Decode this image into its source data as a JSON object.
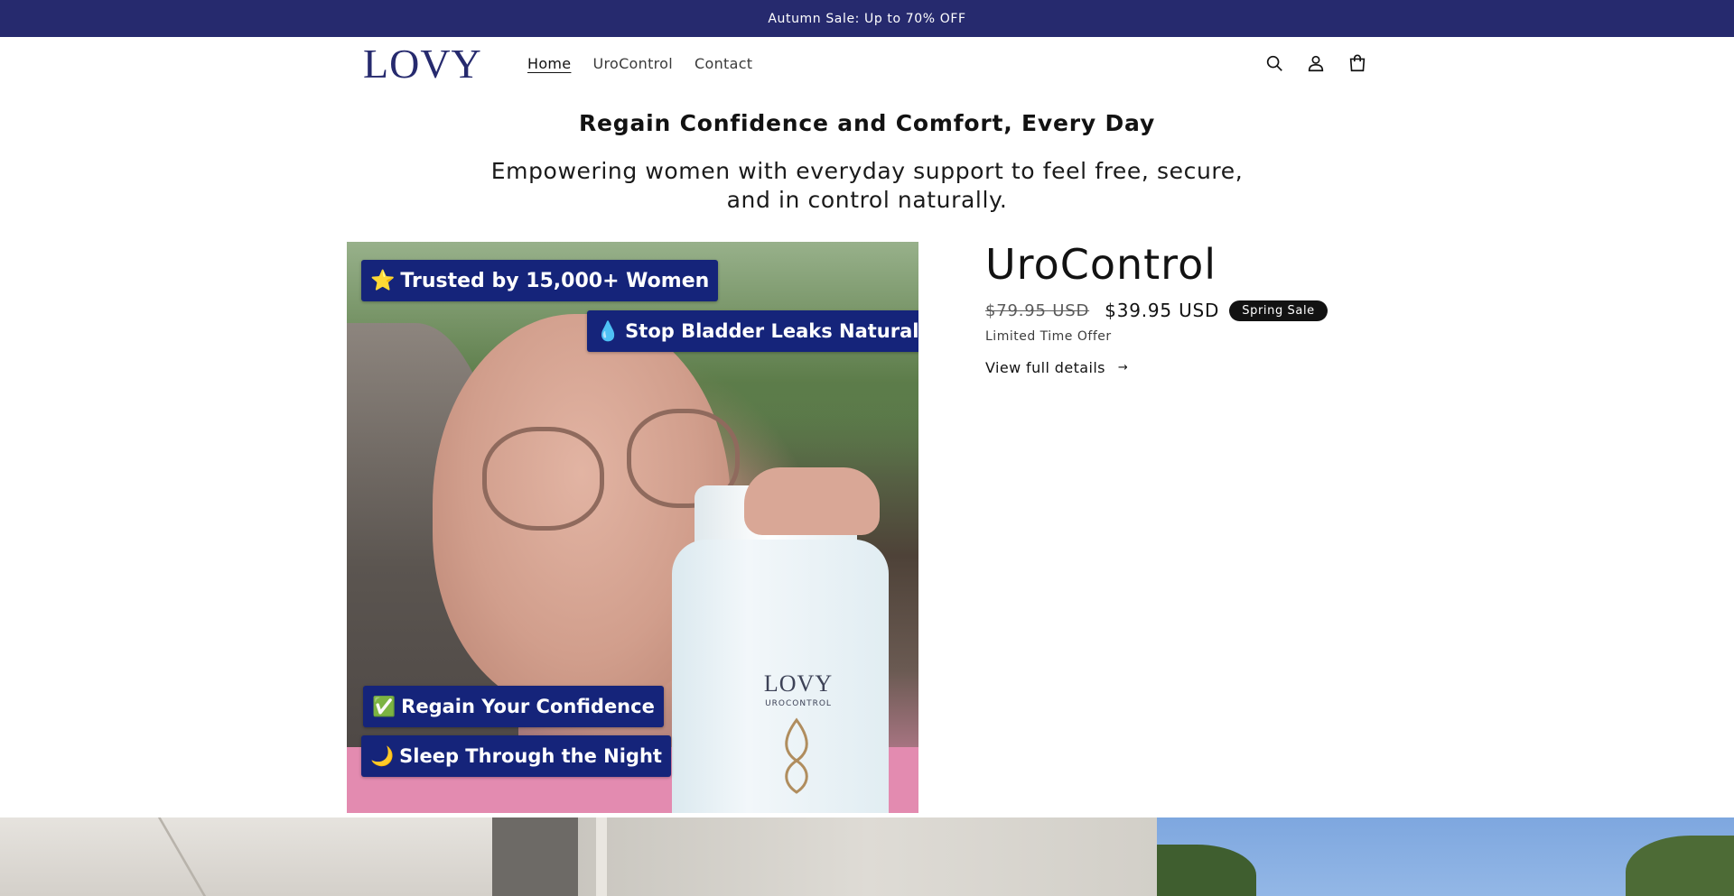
{
  "announcement": {
    "text": "Autumn Sale: Up to 70% OFF"
  },
  "header": {
    "logo": "LOVY",
    "nav": [
      {
        "label": "Home",
        "active": true
      },
      {
        "label": "UroControl",
        "active": false
      },
      {
        "label": "Contact",
        "active": false
      }
    ],
    "icons": [
      "search-icon",
      "account-icon",
      "cart-icon"
    ]
  },
  "hero": {
    "title": "Regain Confidence and Comfort, Every Day",
    "subtitle": "Empowering women with everyday support to feel free, secure, and in control naturally."
  },
  "product_image": {
    "badges": [
      {
        "emoji": "⭐",
        "text": "Trusted by 15,000+ Women"
      },
      {
        "emoji": "💧",
        "text": "Stop Bladder Leaks Naturally"
      },
      {
        "emoji": "✅",
        "text": "Regain Your Confidence"
      },
      {
        "emoji": "🌙",
        "text": "Sleep Through the Night"
      }
    ],
    "bottle_brand": "LOVY",
    "bottle_product": "UROCONTROL"
  },
  "product": {
    "title": "UroControl",
    "price_original": "$79.95 USD",
    "price_sale": "$39.95 USD",
    "sale_badge": "Spring Sale",
    "offer_text": "Limited Time Offer",
    "details_link": "View full details",
    "details_arrow": "→"
  },
  "colors": {
    "brand_navy": "#262a6e",
    "badge_blue": "#15247a",
    "text": "#121212"
  }
}
